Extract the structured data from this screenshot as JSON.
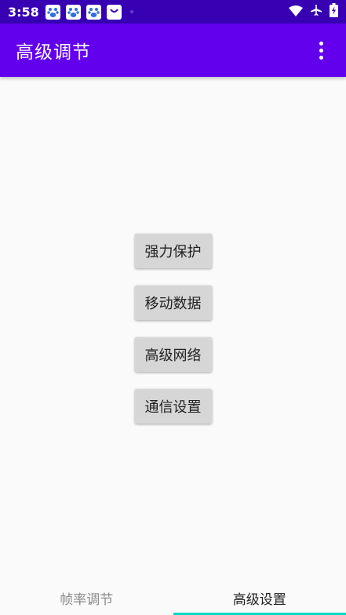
{
  "status_bar": {
    "time": "3:58",
    "notification_icons": [
      "baidu-paw-icon",
      "baidu-paw-icon",
      "baidu-paw-icon",
      "shopping-bag-icon"
    ],
    "system_icons": [
      "wifi-icon",
      "airplane-mode-icon",
      "battery-charging-icon"
    ]
  },
  "app_bar": {
    "title": "高级调节",
    "menu_icon": "overflow-menu-icon"
  },
  "buttons": [
    {
      "label": "强力保护"
    },
    {
      "label": "移动数据"
    },
    {
      "label": "高级网络"
    },
    {
      "label": "通信设置"
    }
  ],
  "tabs": [
    {
      "label": "帧率调节",
      "selected": false
    },
    {
      "label": "高级设置",
      "selected": true
    }
  ],
  "colors": {
    "status_bar": "#3700b3",
    "app_bar": "#6200ee",
    "tab_indicator": "#03dac5",
    "button_bg": "#d6d6d6"
  }
}
